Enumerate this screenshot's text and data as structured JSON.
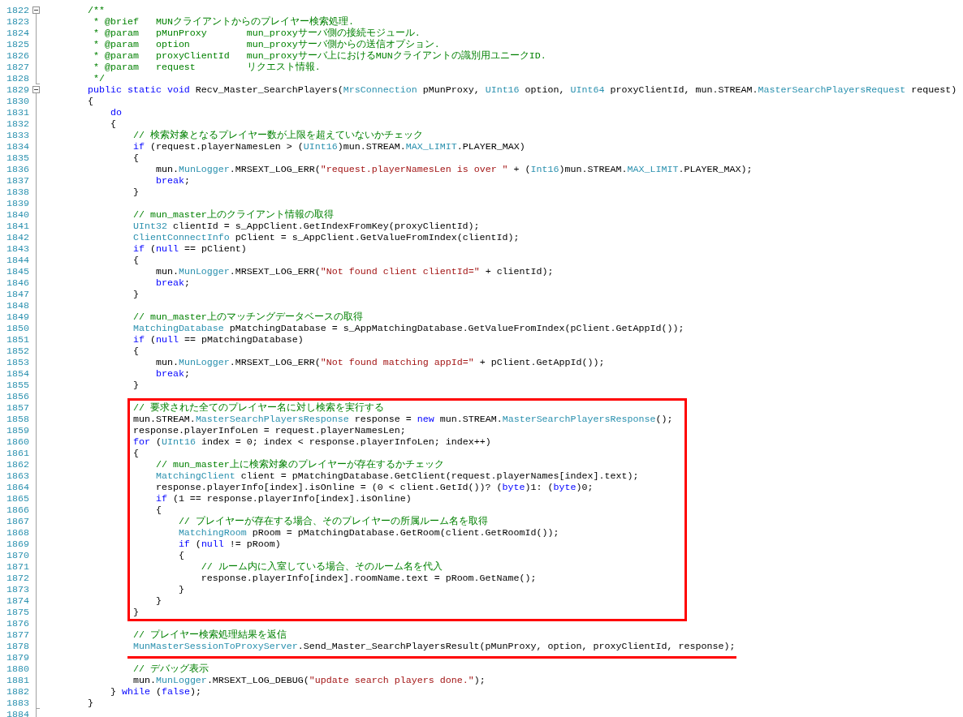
{
  "segments": [
    {
      "kind": "plain",
      "lines": [
        {
          "number": "1822",
          "expanded": true,
          "tokens": [
            {
              "kind": "comment",
              "text": "        /**"
            }
          ]
        },
        {
          "number": "1823",
          "tokens": [
            {
              "kind": "comment",
              "text": "         * @brief   MUNクライアントからのプレイヤー検索処理."
            }
          ]
        },
        {
          "number": "1824",
          "tokens": [
            {
              "kind": "comment",
              "text": "         * @param   pMunProxy       mun_proxyサーバ側の接続モジュール."
            }
          ]
        },
        {
          "number": "1825",
          "tokens": [
            {
              "kind": "comment",
              "text": "         * @param   option          mun_proxyサーバ側からの送信オプション."
            }
          ]
        },
        {
          "number": "1826",
          "tokens": [
            {
              "kind": "comment",
              "text": "         * @param   proxyClientId   mun_proxyサーバ上におけるMUNクライアントの識別用ユニークID."
            }
          ]
        },
        {
          "number": "1827",
          "tokens": [
            {
              "kind": "comment",
              "text": "         * @param   request         リクエスト情報."
            }
          ]
        },
        {
          "number": "1828",
          "tokens": [
            {
              "kind": "comment",
              "text": "         */"
            }
          ]
        },
        {
          "number": "1829",
          "expanded": true,
          "tokens": [
            {
              "kind": "keyword",
              "text": "        public static void"
            },
            {
              "kind": "plain",
              "text": " Recv_Master_SearchPlayers("
            },
            {
              "kind": "type",
              "text": "MrsConnection"
            },
            {
              "kind": "plain",
              "text": " pMunProxy, "
            },
            {
              "kind": "type",
              "text": "UInt16"
            },
            {
              "kind": "plain",
              "text": " option, "
            },
            {
              "kind": "type",
              "text": "UInt64"
            },
            {
              "kind": "plain",
              "text": " proxyClientId, mun.STREAM."
            },
            {
              "kind": "type",
              "text": "MasterSearchPlayersRequest"
            },
            {
              "kind": "plain",
              "text": " request)"
            }
          ]
        },
        {
          "number": "1830",
          "tokens": [
            {
              "kind": "plain",
              "text": "        {"
            }
          ]
        },
        {
          "number": "1831",
          "tokens": [
            {
              "kind": "keyword",
              "text": "            do"
            }
          ]
        },
        {
          "number": "1832",
          "tokens": [
            {
              "kind": "plain",
              "text": "            {"
            }
          ]
        },
        {
          "number": "1833",
          "tokens": [
            {
              "kind": "comment",
              "text": "                // 検索対象となるプレイヤー数が上限を超えていないかチェック"
            }
          ]
        },
        {
          "number": "1834",
          "tokens": [
            {
              "kind": "keyword",
              "text": "                if"
            },
            {
              "kind": "plain",
              "text": " (request.playerNamesLen > ("
            },
            {
              "kind": "type",
              "text": "UInt16"
            },
            {
              "kind": "plain",
              "text": ")mun.STREAM."
            },
            {
              "kind": "type",
              "text": "MAX_LIMIT"
            },
            {
              "kind": "plain",
              "text": ".PLAYER_MAX)"
            }
          ]
        },
        {
          "number": "1835",
          "tokens": [
            {
              "kind": "plain",
              "text": "                {"
            }
          ]
        },
        {
          "number": "1836",
          "tokens": [
            {
              "kind": "plain",
              "text": "                    mun."
            },
            {
              "kind": "type",
              "text": "MunLogger"
            },
            {
              "kind": "plain",
              "text": ".MRSEXT_LOG_ERR("
            },
            {
              "kind": "string",
              "text": "\"request.playerNamesLen is over \""
            },
            {
              "kind": "plain",
              "text": " + ("
            },
            {
              "kind": "type",
              "text": "Int16"
            },
            {
              "kind": "plain",
              "text": ")mun.STREAM."
            },
            {
              "kind": "type",
              "text": "MAX_LIMIT"
            },
            {
              "kind": "plain",
              "text": ".PLAYER_MAX);"
            }
          ]
        },
        {
          "number": "1837",
          "tokens": [
            {
              "kind": "keyword",
              "text": "                    break"
            },
            {
              "kind": "plain",
              "text": ";"
            }
          ]
        },
        {
          "number": "1838",
          "tokens": [
            {
              "kind": "plain",
              "text": "                }"
            }
          ]
        },
        {
          "number": "1839"
        },
        {
          "number": "1840",
          "tokens": [
            {
              "kind": "comment",
              "text": "                // mun_master上のクライアント情報の取得"
            }
          ]
        },
        {
          "number": "1841",
          "tokens": [
            {
              "kind": "type",
              "text": "                UInt32"
            },
            {
              "kind": "plain",
              "text": " clientId = s_AppClient.GetIndexFromKey(proxyClientId);"
            }
          ]
        },
        {
          "number": "1842",
          "tokens": [
            {
              "kind": "type",
              "text": "                ClientConnectInfo"
            },
            {
              "kind": "plain",
              "text": " pClient = s_AppClient.GetValueFromIndex(clientId);"
            }
          ]
        },
        {
          "number": "1843",
          "tokens": [
            {
              "kind": "keyword",
              "text": "                if"
            },
            {
              "kind": "plain",
              "text": " ("
            },
            {
              "kind": "keyword",
              "text": "null"
            },
            {
              "kind": "plain",
              "text": " == pClient)"
            }
          ]
        },
        {
          "number": "1844",
          "tokens": [
            {
              "kind": "plain",
              "text": "                {"
            }
          ]
        },
        {
          "number": "1845",
          "tokens": [
            {
              "kind": "plain",
              "text": "                    mun."
            },
            {
              "kind": "type",
              "text": "MunLogger"
            },
            {
              "kind": "plain",
              "text": ".MRSEXT_LOG_ERR("
            },
            {
              "kind": "string",
              "text": "\"Not found client clientId=\""
            },
            {
              "kind": "plain",
              "text": " + clientId);"
            }
          ]
        },
        {
          "number": "1846",
          "tokens": [
            {
              "kind": "keyword",
              "text": "                    break"
            },
            {
              "kind": "plain",
              "text": ";"
            }
          ]
        },
        {
          "number": "1847",
          "tokens": [
            {
              "kind": "plain",
              "text": "                }"
            }
          ]
        },
        {
          "number": "1848"
        },
        {
          "number": "1849",
          "tokens": [
            {
              "kind": "comment",
              "text": "                // mun_master上のマッチングデータベースの取得"
            }
          ]
        },
        {
          "number": "1850",
          "tokens": [
            {
              "kind": "type",
              "text": "                MatchingDatabase"
            },
            {
              "kind": "plain",
              "text": " pMatchingDatabase = s_AppMatchingDatabase.GetValueFromIndex(pClient.GetAppId());"
            }
          ]
        },
        {
          "number": "1851",
          "tokens": [
            {
              "kind": "keyword",
              "text": "                if"
            },
            {
              "kind": "plain",
              "text": " ("
            },
            {
              "kind": "keyword",
              "text": "null"
            },
            {
              "kind": "plain",
              "text": " == pMatchingDatabase)"
            }
          ]
        },
        {
          "number": "1852",
          "tokens": [
            {
              "kind": "plain",
              "text": "                {"
            }
          ]
        },
        {
          "number": "1853",
          "tokens": [
            {
              "kind": "plain",
              "text": "                    mun."
            },
            {
              "kind": "type",
              "text": "MunLogger"
            },
            {
              "kind": "plain",
              "text": ".MRSEXT_LOG_ERR("
            },
            {
              "kind": "string",
              "text": "\"Not found matching appId=\""
            },
            {
              "kind": "plain",
              "text": " + pClient.GetAppId());"
            }
          ]
        },
        {
          "number": "1854",
          "tokens": [
            {
              "kind": "keyword",
              "text": "                    break"
            },
            {
              "kind": "plain",
              "text": ";"
            }
          ]
        },
        {
          "number": "1855",
          "tokens": [
            {
              "kind": "plain",
              "text": "                }"
            }
          ]
        },
        {
          "number": "1856"
        }
      ]
    },
    {
      "kind": "boxed",
      "lines": [
        {
          "number": "1857",
          "tokens": [
            {
              "kind": "comment",
              "text": "                // 要求された全てのプレイヤー名に対し検索を実行する"
            }
          ]
        },
        {
          "number": "1858",
          "tokens": [
            {
              "kind": "plain",
              "text": "                mun.STREAM."
            },
            {
              "kind": "type",
              "text": "MasterSearchPlayersResponse"
            },
            {
              "kind": "plain",
              "text": " response = "
            },
            {
              "kind": "keyword",
              "text": "new"
            },
            {
              "kind": "plain",
              "text": " mun.STREAM."
            },
            {
              "kind": "type",
              "text": "MasterSearchPlayersResponse"
            },
            {
              "kind": "plain",
              "text": "();"
            }
          ]
        },
        {
          "number": "1859",
          "tokens": [
            {
              "kind": "plain",
              "text": "                response.playerInfoLen = request.playerNamesLen;"
            }
          ]
        },
        {
          "number": "1860",
          "tokens": [
            {
              "kind": "keyword",
              "text": "                for"
            },
            {
              "kind": "plain",
              "text": " ("
            },
            {
              "kind": "type",
              "text": "UInt16"
            },
            {
              "kind": "plain",
              "text": " index = 0; index < response.playerInfoLen; index++)"
            }
          ]
        },
        {
          "number": "1861",
          "tokens": [
            {
              "kind": "plain",
              "text": "                {"
            }
          ]
        },
        {
          "number": "1862",
          "tokens": [
            {
              "kind": "comment",
              "text": "                    // mun_master上に検索対象のプレイヤーが存在するかチェック"
            }
          ]
        },
        {
          "number": "1863",
          "tokens": [
            {
              "kind": "type",
              "text": "                    MatchingClient"
            },
            {
              "kind": "plain",
              "text": " client = pMatchingDatabase.GetClient(request.playerNames[index].text);"
            }
          ]
        },
        {
          "number": "1864",
          "tokens": [
            {
              "kind": "plain",
              "text": "                    response.playerInfo[index].isOnline = (0 < client.GetId())? ("
            },
            {
              "kind": "keyword",
              "text": "byte"
            },
            {
              "kind": "plain",
              "text": ")1: ("
            },
            {
              "kind": "keyword",
              "text": "byte"
            },
            {
              "kind": "plain",
              "text": ")0;"
            }
          ]
        },
        {
          "number": "1865",
          "tokens": [
            {
              "kind": "keyword",
              "text": "                    if"
            },
            {
              "kind": "plain",
              "text": " (1 == response.playerInfo[index].isOnline)"
            }
          ]
        },
        {
          "number": "1866",
          "tokens": [
            {
              "kind": "plain",
              "text": "                    {"
            }
          ]
        },
        {
          "number": "1867",
          "tokens": [
            {
              "kind": "comment",
              "text": "                        // プレイヤーが存在する場合、そのプレイヤーの所属ルーム名を取得"
            }
          ]
        },
        {
          "number": "1868",
          "tokens": [
            {
              "kind": "type",
              "text": "                        MatchingRoom"
            },
            {
              "kind": "plain",
              "text": " pRoom = pMatchingDatabase.GetRoom(client.GetRoomId());"
            }
          ]
        },
        {
          "number": "1869",
          "tokens": [
            {
              "kind": "keyword",
              "text": "                        if"
            },
            {
              "kind": "plain",
              "text": " ("
            },
            {
              "kind": "keyword",
              "text": "null"
            },
            {
              "kind": "plain",
              "text": " != pRoom)"
            }
          ]
        },
        {
          "number": "1870",
          "tokens": [
            {
              "kind": "plain",
              "text": "                        {"
            }
          ]
        },
        {
          "number": "1871",
          "tokens": [
            {
              "kind": "comment",
              "text": "                            // ルーム内に入室している場合、そのルーム名を代入"
            }
          ]
        },
        {
          "number": "1872",
          "tokens": [
            {
              "kind": "plain",
              "text": "                            response.playerInfo[index].roomName.text = pRoom.GetName();"
            }
          ]
        },
        {
          "number": "1873",
          "tokens": [
            {
              "kind": "plain",
              "text": "                        }"
            }
          ]
        },
        {
          "number": "1874",
          "tokens": [
            {
              "kind": "plain",
              "text": "                    }"
            }
          ]
        },
        {
          "number": "1875",
          "tokens": [
            {
              "kind": "plain",
              "text": "                }"
            }
          ]
        }
      ]
    },
    {
      "kind": "plain",
      "lines": [
        {
          "number": "1876"
        },
        {
          "number": "1877",
          "tokens": [
            {
              "kind": "comment",
              "text": "                // プレイヤー検索処理結果を返信"
            }
          ]
        }
      ]
    },
    {
      "kind": "underlined",
      "lines": [
        {
          "number": "1878",
          "tokens": [
            {
              "kind": "type",
              "text": "                MunMasterSessionToProxyServer"
            },
            {
              "kind": "plain",
              "text": ".Send_Master_SearchPlayersResult(pMunProxy, option, proxyClientId, response);"
            }
          ]
        }
      ]
    },
    {
      "kind": "plain",
      "lines": [
        {
          "number": "1879"
        },
        {
          "number": "1880",
          "tokens": [
            {
              "kind": "comment",
              "text": "                // デバッグ表示"
            }
          ]
        },
        {
          "number": "1881",
          "tokens": [
            {
              "kind": "plain",
              "text": "                mun."
            },
            {
              "kind": "type",
              "text": "MunLogger"
            },
            {
              "kind": "plain",
              "text": ".MRSEXT_LOG_DEBUG("
            },
            {
              "kind": "string",
              "text": "\"update search players done.\""
            },
            {
              "kind": "plain",
              "text": ");"
            }
          ]
        },
        {
          "number": "1882",
          "tokens": [
            {
              "kind": "plain",
              "text": "            } "
            },
            {
              "kind": "keyword",
              "text": "while"
            },
            {
              "kind": "plain",
              "text": " ("
            },
            {
              "kind": "keyword",
              "text": "false"
            },
            {
              "kind": "plain",
              "text": ");"
            }
          ]
        },
        {
          "number": "1883",
          "tokens": [
            {
              "kind": "plain",
              "text": "        }"
            }
          ]
        },
        {
          "number": "1884"
        }
      ]
    }
  ]
}
